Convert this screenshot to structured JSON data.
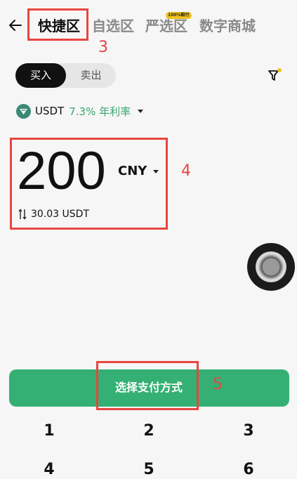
{
  "nav": {
    "tabs": [
      {
        "label": "快捷区"
      },
      {
        "label": "自选区"
      },
      {
        "label": "严选区",
        "badge": "100%赔付"
      },
      {
        "label": "数字商城"
      }
    ]
  },
  "annotations": {
    "n3": "3",
    "n4": "4",
    "n5": "5"
  },
  "trade": {
    "buy_label": "买入",
    "sell_label": "卖出"
  },
  "coin": {
    "name": "USDT",
    "rate": "7.3% 年利率"
  },
  "amount": {
    "value": "200",
    "currency": "CNY",
    "converted": "30.03 USDT"
  },
  "pay": {
    "label": "选择支付方式"
  },
  "keypad": {
    "keys": [
      "1",
      "2",
      "3",
      "4",
      "5",
      "6"
    ]
  },
  "colors": {
    "accent_green": "#35b074",
    "annotation_red": "#e8463f",
    "badge_yellow": "#f2c21b"
  }
}
